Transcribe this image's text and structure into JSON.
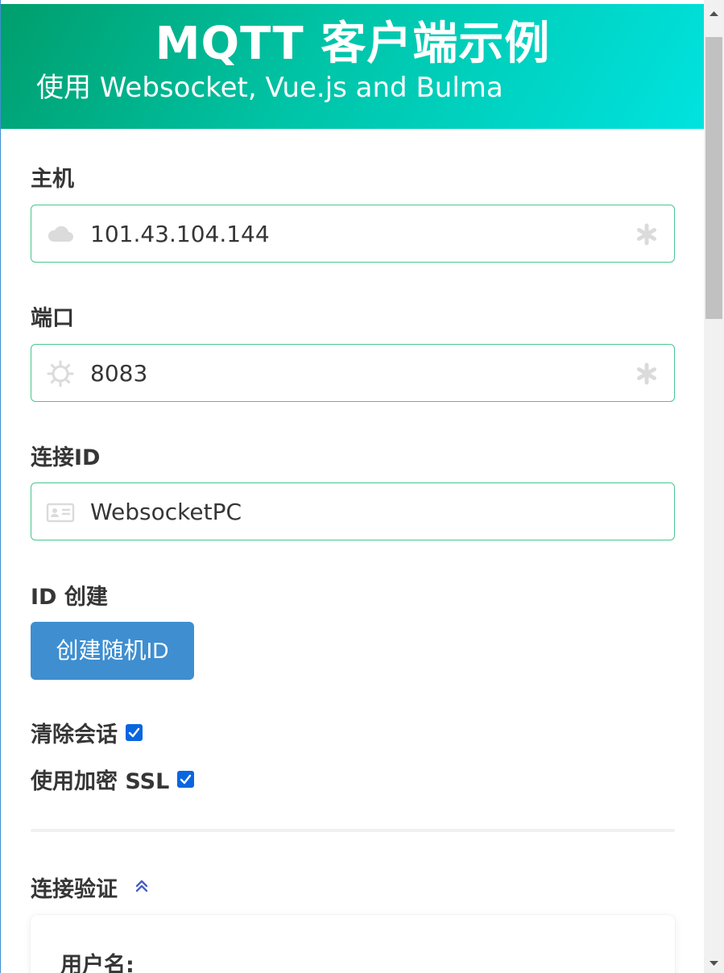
{
  "hero": {
    "title": "MQTT 客户端示例",
    "subtitle": "使用 Websocket, Vue.js and Bulma"
  },
  "host": {
    "label": "主机",
    "value": "101.43.104.144",
    "left_icon": "cloud-icon",
    "right_icon": "asterisk-icon"
  },
  "port": {
    "label": "端口",
    "value": "8083",
    "left_icon": "gear-icon",
    "right_icon": "asterisk-icon"
  },
  "client_id": {
    "label": "连接ID",
    "value": "WebsocketPC",
    "left_icon": "id-card-icon"
  },
  "id_create": {
    "label": "ID 创建",
    "button_label": "创建随机ID"
  },
  "clean_session": {
    "label": "清除会话",
    "checked": true
  },
  "use_ssl": {
    "label": "使用加密 SSL",
    "checked": true
  },
  "auth": {
    "title": "连接验证",
    "toggle_icon": "chevron-double-up-icon",
    "username_label": "用户名:"
  },
  "colors": {
    "hero_start": "#009e6c",
    "hero_end": "#00e3e0",
    "field_border": "#48c78e",
    "button": "#3e8ed0",
    "checkbox": "#0a66e0",
    "toggle_icon": "#485fc7"
  }
}
